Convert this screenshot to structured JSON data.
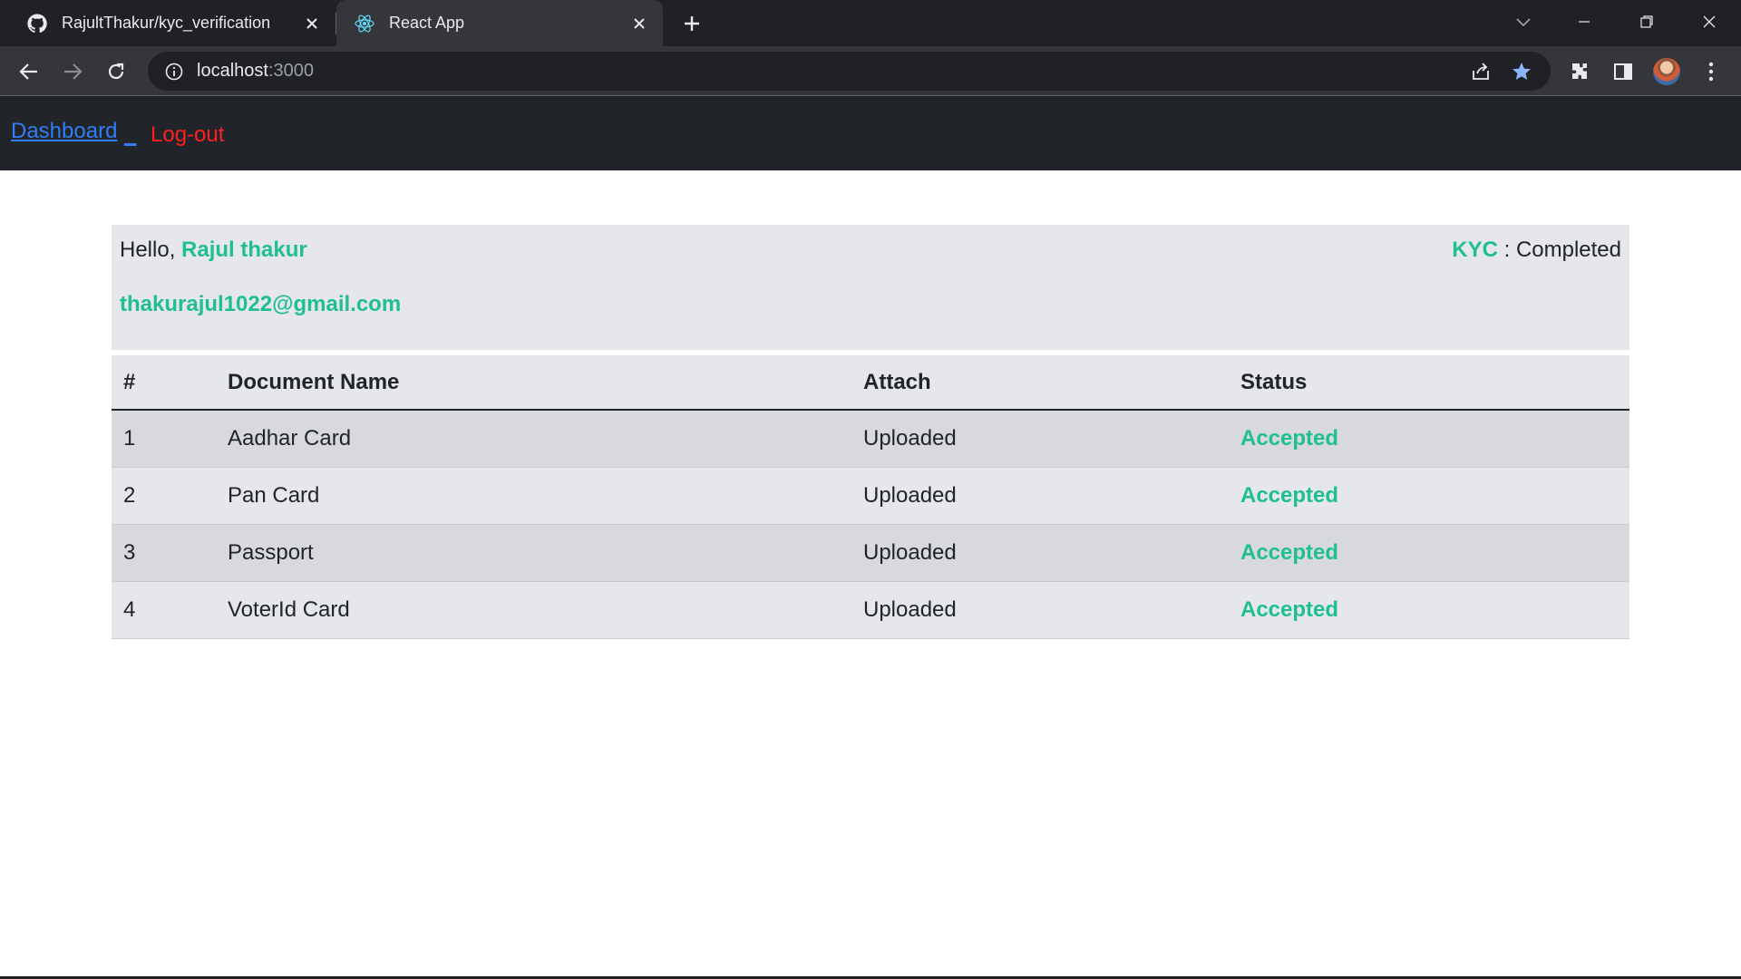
{
  "browser": {
    "tabs": [
      {
        "title": "RajultThakur/kyc_verification",
        "icon": "github-icon",
        "active": false
      },
      {
        "title": "React App",
        "icon": "react-icon",
        "active": true
      }
    ],
    "url": {
      "host": "localhost",
      "port": ":3000"
    }
  },
  "navbar": {
    "dashboard_label": "Dashboard",
    "separator": "_",
    "logout_label": "Log-out"
  },
  "user": {
    "greeting": "Hello, ",
    "name": "Rajul thakur",
    "email": "thakurajul1022@gmail.com",
    "kyc_label": "KYC",
    "kyc_separator": " : ",
    "kyc_status": "Completed"
  },
  "table": {
    "headers": [
      "#",
      "Document Name",
      "Attach",
      "Status"
    ],
    "rows": [
      {
        "index": "1",
        "name": "Aadhar Card",
        "attach": "Uploaded",
        "status": "Accepted"
      },
      {
        "index": "2",
        "name": "Pan Card",
        "attach": "Uploaded",
        "status": "Accepted"
      },
      {
        "index": "3",
        "name": "Passport",
        "attach": "Uploaded",
        "status": "Accepted"
      },
      {
        "index": "4",
        "name": "VoterId Card",
        "attach": "Uploaded",
        "status": "Accepted"
      }
    ]
  },
  "colors": {
    "accent_green": "#20c08c",
    "link_blue": "#2f7df6",
    "logout_red": "#ff1f1f",
    "navbar_bg": "#212529"
  }
}
